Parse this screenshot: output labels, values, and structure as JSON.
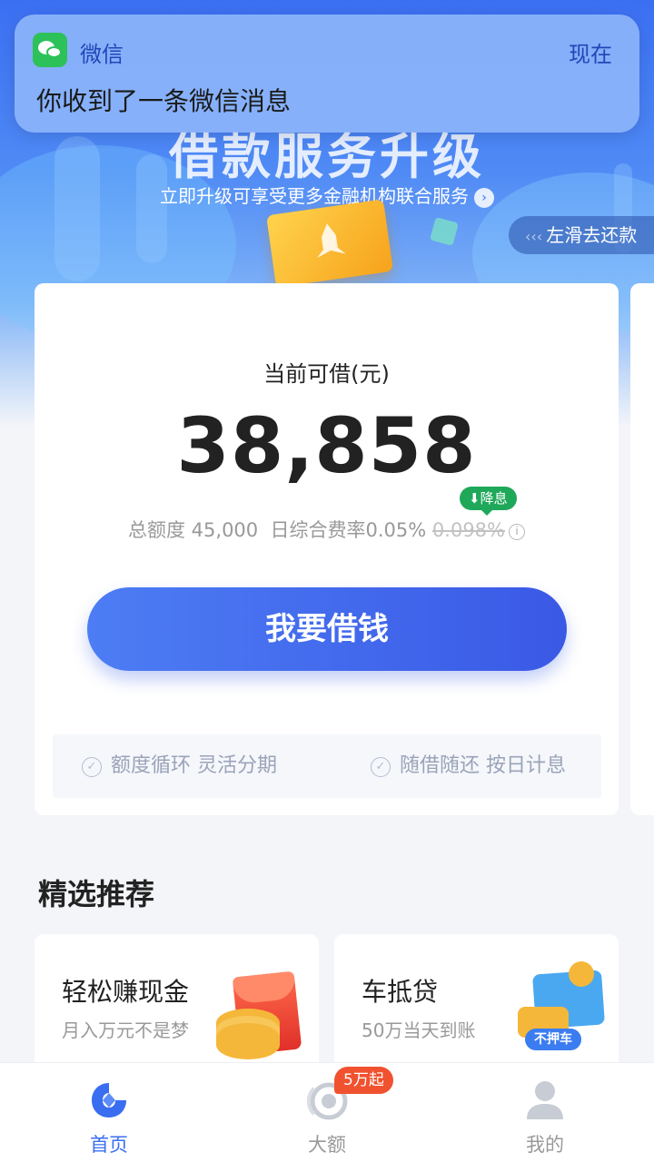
{
  "notification": {
    "app_name": "微信",
    "time": "现在",
    "message": "你收到了一条微信消息"
  },
  "banner": {
    "title": "借款服务升级",
    "subtitle": "立即升级可享受更多金融机构联合服务",
    "swipe_hint": "左滑去还款"
  },
  "loan_card": {
    "label": "当前可借(元)",
    "amount": "38,858",
    "total_quota_label": "总额度",
    "total_quota": "45,000",
    "rate_label": "日综合费率",
    "rate": "0.05%",
    "old_rate": "0.098%",
    "rate_badge": "降息",
    "borrow_button": "我要借钱",
    "features": [
      "额度循环 灵活分期",
      "随借随还 按日计息"
    ]
  },
  "recommend": {
    "title": "精选推荐",
    "items": [
      {
        "title": "轻松赚现金",
        "subtitle": "月入万元不是梦"
      },
      {
        "title": "车抵贷",
        "subtitle": "50万当天到账",
        "tag": "不押车"
      }
    ]
  },
  "tabbar": {
    "items": [
      {
        "label": "首页",
        "icon": "home-icon",
        "active": true
      },
      {
        "label": "大额",
        "icon": "large-loan-icon",
        "badge": "5万起"
      },
      {
        "label": "我的",
        "icon": "profile-icon"
      }
    ]
  },
  "colors": {
    "accent": "#3a6ef0",
    "wechat_green": "#2dc15a",
    "rate_badge": "#1fa85a",
    "tab_badge": "#f0522f"
  }
}
